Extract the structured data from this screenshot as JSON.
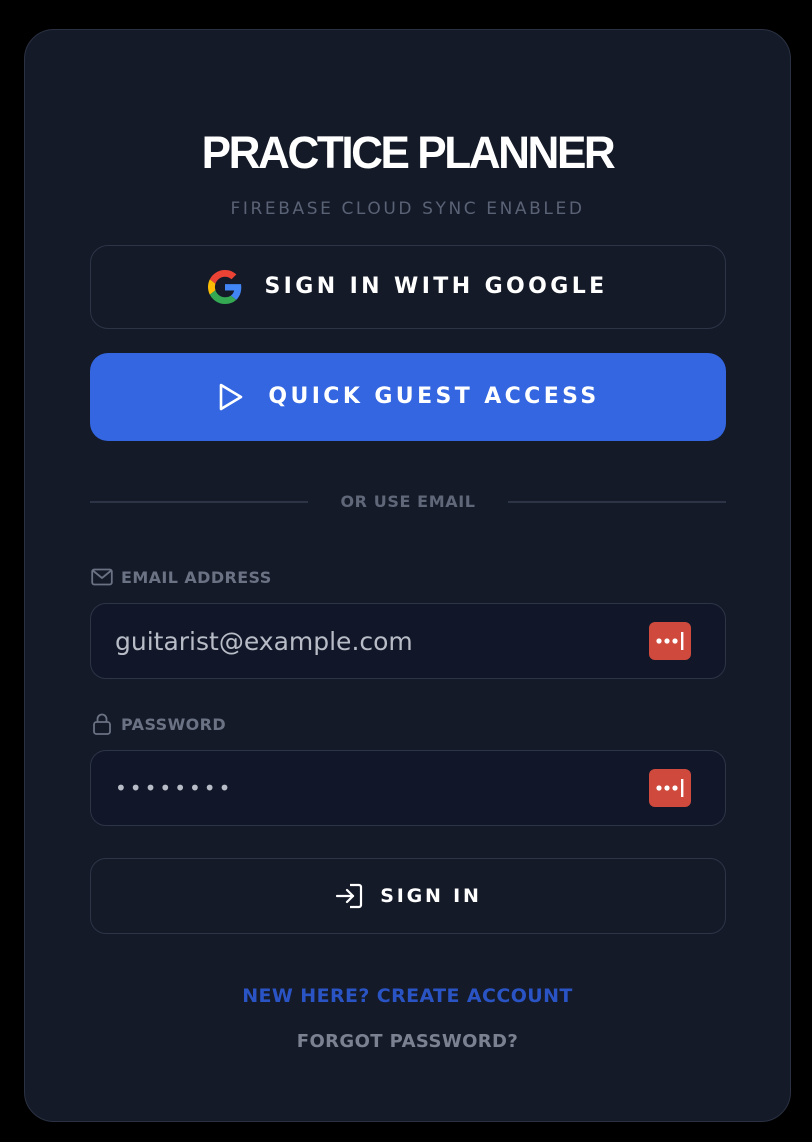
{
  "app": {
    "title": "PRACTICE PLANNER",
    "subtitle": "FIREBASE CLOUD SYNC ENABLED"
  },
  "auth": {
    "google_label": "SIGN IN WITH GOOGLE",
    "guest_label": "QUICK GUEST ACCESS",
    "divider_label": "OR USE EMAIL",
    "signin_label": "SIGN IN"
  },
  "form": {
    "email_label": "EMAIL ADDRESS",
    "email_value": "guitarist@example.com",
    "password_label": "PASSWORD",
    "password_value": "********"
  },
  "links": {
    "create_account": "NEW HERE? CREATE ACCOUNT",
    "forgot_password": "FORGOT PASSWORD?"
  },
  "icons": {
    "google": "google-icon",
    "guest": "play-icon",
    "email": "mail-icon",
    "password": "lock-icon",
    "password_manager": "password-manager-icon",
    "signin": "sign-in-icon"
  },
  "colors": {
    "accent": "#3366e0",
    "background": "#141a28",
    "link": "#2a54c4",
    "password_manager": "#cf4a3d"
  }
}
